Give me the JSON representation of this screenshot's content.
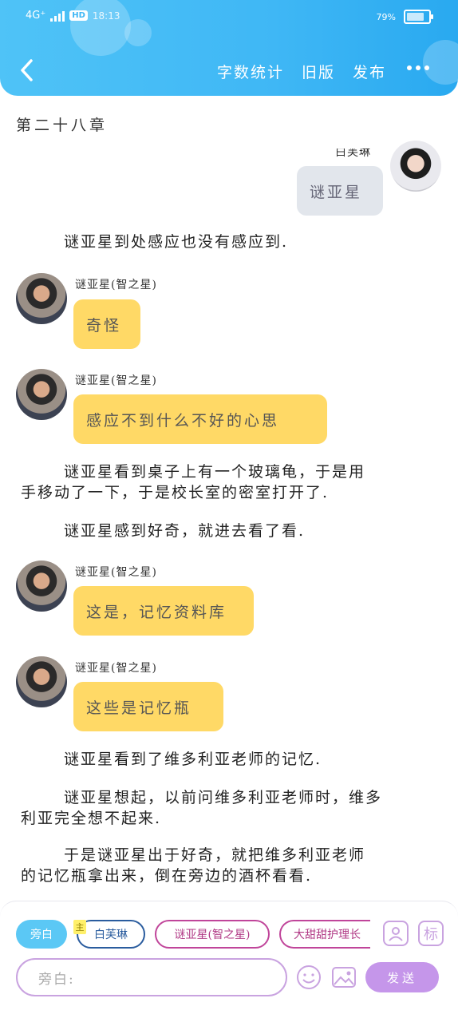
{
  "status_bar": {
    "network": "4G⁺",
    "hd": "HD",
    "time": "18:13",
    "battery_text": "79%",
    "battery_level": 0.79
  },
  "header": {
    "back_icon": "chevron-left-icon",
    "actions": [
      "字数统计",
      "旧版",
      "发布"
    ],
    "more_icon": "more-dots-icon"
  },
  "chapter": {
    "title": "第二十八章"
  },
  "messages": {
    "right_partial_name": "白芙琳",
    "right_bubble": "谜亚星",
    "n1": "谜亚星到处感应也没有感应到.",
    "speaker": "谜亚星(智之星)",
    "b1": "奇怪",
    "b2": "感应不到什么不好的心思",
    "n2a": "谜亚星看到桌子上有一个玻璃龟，于是用",
    "n2b": "手移动了一下，于是校长室的密室打开了.",
    "n3": "谜亚星感到好奇，就进去看了看.",
    "b3": "这是，记忆资料库",
    "b4": "这些是记忆瓶",
    "n4": "谜亚星看到了维多利亚老师的记忆.",
    "n5a": "谜亚星想起，以前问维多利亚老师时，维多",
    "n5b": "利亚完全想不起来.",
    "n6a": "于是谜亚星出于好奇，就把维多利亚老师",
    "n6b": "的记忆瓶拿出来，倒在旁边的酒杯看看."
  },
  "bottom": {
    "role_chips": [
      "旁白",
      "白芙琳",
      "谜亚星(智之星)",
      "大甜甜护理长"
    ],
    "main_tag": "主",
    "right_icon_label": "标",
    "input_placeholder": "旁白:",
    "send_label": "发送",
    "accent_color": "#c596ea"
  }
}
